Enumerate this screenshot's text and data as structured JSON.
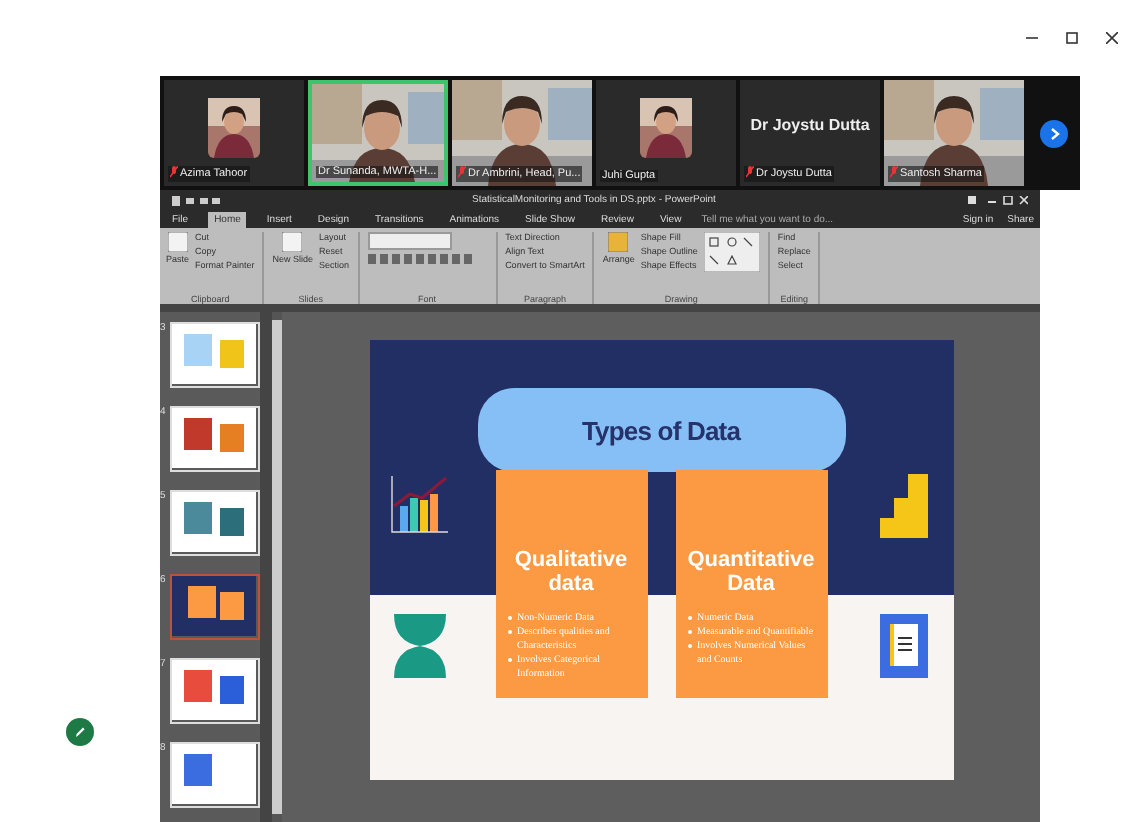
{
  "participants": [
    {
      "name": "Azima Tahoor",
      "muted": true,
      "speaking": false
    },
    {
      "name": "Dr Sunanda, MWTA-H...",
      "kind": "video",
      "muted": false,
      "speaking": true
    },
    {
      "name": "Dr Ambrini, Head, Pu...",
      "kind": "video",
      "muted": true,
      "speaking": false
    },
    {
      "name": "Juhi Gupta",
      "muted": false,
      "speaking": false
    },
    {
      "name": "Dr Joystu Dutta",
      "kind": "name",
      "display": "Dr Joystu Dutta",
      "muted": true,
      "speaking": false
    },
    {
      "name": "Santosh Sharma",
      "kind": "video",
      "muted": true,
      "speaking": false
    }
  ],
  "ppt": {
    "title": "StatisticalMonitoring and Tools in DS.pptx - PowerPoint",
    "tabs": [
      {
        "label": "File",
        "selected": false
      },
      {
        "label": "Home",
        "selected": true
      },
      {
        "label": "Insert",
        "selected": false
      },
      {
        "label": "Design",
        "selected": false
      },
      {
        "label": "Transitions",
        "selected": false
      },
      {
        "label": "Animations",
        "selected": false
      },
      {
        "label": "Slide Show",
        "selected": false
      },
      {
        "label": "Review",
        "selected": false
      },
      {
        "label": "View",
        "selected": false
      }
    ],
    "tell_me": "Tell me what you want to do...",
    "sign_in": "Sign in",
    "share": "Share",
    "ribbon": [
      {
        "label": "Clipboard",
        "items": [
          "Cut",
          "Copy",
          "Format Painter"
        ],
        "big": "Paste"
      },
      {
        "label": "Slides",
        "items": [
          "Layout",
          "Reset",
          "Section"
        ],
        "big": "New Slide"
      },
      {
        "label": "Font"
      },
      {
        "label": "Paragraph",
        "items": [
          "Text Direction",
          "Align Text",
          "Convert to SmartArt"
        ]
      },
      {
        "label": "Drawing",
        "items": [
          "Shape Fill",
          "Shape Outline",
          "Shape Effects"
        ],
        "big": "Arrange"
      },
      {
        "label": "Editing",
        "items": [
          "Find",
          "Replace",
          "Select"
        ]
      }
    ],
    "thumbnails": [
      {
        "number": "3",
        "selected": false
      },
      {
        "number": "4",
        "selected": false
      },
      {
        "number": "5",
        "selected": false
      },
      {
        "number": "6",
        "selected": true
      },
      {
        "number": "7",
        "selected": false
      },
      {
        "number": "8",
        "selected": false
      }
    ],
    "slide": {
      "title": "Types of Data",
      "boxes": [
        {
          "heading": "Qualitative data",
          "bullets": [
            "Non-Numeric Data",
            "Describes qualities and Characteristics",
            "Involves Categorical Information"
          ]
        },
        {
          "heading": "Quantitative Data",
          "bullets": [
            "Numeric Data",
            "Measurable and Quantifiable",
            "Involves Numerical Values and Counts"
          ]
        }
      ]
    }
  }
}
